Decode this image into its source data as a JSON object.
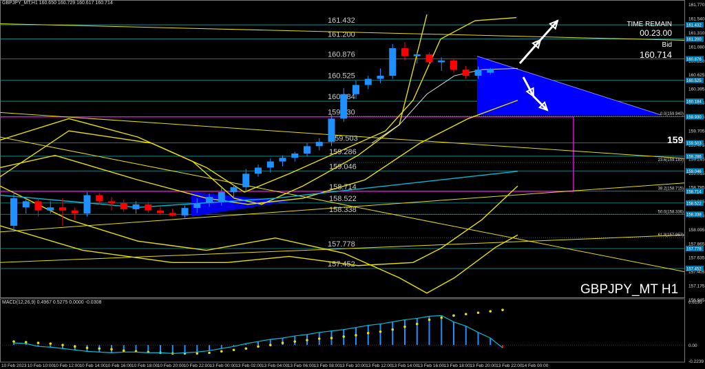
{
  "header": {
    "text": "GBPJPY_MT,H1  160.650 160.729 160.617 160.714"
  },
  "info": {
    "time_remain_label": "TIME REMAIN",
    "time_remain": "00.23.00",
    "bid_label": "Bid",
    "bid": "160.714"
  },
  "symbol_label": "GBPJPY_MT H1",
  "macd_label": "MACD(12,26,9) 0.4967 0.5275 0.0000 -0.0308",
  "big_label": "159",
  "colors": {
    "bull": "#1e90ff",
    "bear": "#ff0000",
    "bands": "#e8e000",
    "cyan": "#00bcd4",
    "magenta": "#ff00ff",
    "triangle": "#0000ff"
  },
  "chart_data": {
    "type": "candlestick",
    "y_range": [
      156.98,
      161.77
    ],
    "y_ticks": [
      "161.770",
      "161.540",
      "161.310",
      "161.080",
      "160.850",
      "160.625",
      "160.395",
      "160.165",
      "159.935",
      "159.705",
      "159.475",
      "159.245",
      "159.015",
      "158.785",
      "158.555",
      "158.325",
      "158.095",
      "157.865",
      "157.635",
      "157.405",
      "157.175",
      "156.945"
    ],
    "price_levels": [
      {
        "label": "161.432",
        "value": 161.432
      },
      {
        "label": "161.200",
        "value": 161.2
      },
      {
        "label": "160.876",
        "value": 160.876
      },
      {
        "label": "160.525",
        "value": 160.525
      },
      {
        "label": "160.184",
        "value": 160.184
      },
      {
        "label": "159.930",
        "value": 159.93
      },
      {
        "label": "159.503",
        "value": 159.503
      },
      {
        "label": "159.286",
        "value": 159.286
      },
      {
        "label": "159.046",
        "value": 159.046
      },
      {
        "label": "158.714",
        "value": 158.714
      },
      {
        "label": "158.522",
        "value": 158.522
      },
      {
        "label": "158.338",
        "value": 158.338
      },
      {
        "label": "157.778",
        "value": 157.778
      },
      {
        "label": "157.452",
        "value": 157.452
      }
    ],
    "fib_labels": [
      {
        "label": "0.0(159.940)",
        "value": 159.94
      },
      {
        "label": "23.6(159.183)",
        "value": 159.183
      },
      {
        "label": "38.2(158.715)",
        "value": 158.715
      },
      {
        "label": "50.0(158.336)",
        "value": 158.336
      },
      {
        "label": "61.8(157.957)",
        "value": 157.957
      }
    ],
    "candles": [
      {
        "o": 158.15,
        "h": 158.7,
        "l": 158.05,
        "c": 158.6
      },
      {
        "o": 158.45,
        "h": 158.62,
        "l": 158.35,
        "c": 158.55
      },
      {
        "o": 158.55,
        "h": 158.6,
        "l": 158.3,
        "c": 158.4
      },
      {
        "o": 158.4,
        "h": 158.55,
        "l": 158.35,
        "c": 158.45
      },
      {
        "o": 158.45,
        "h": 158.6,
        "l": 158.15,
        "c": 158.4
      },
      {
        "o": 158.4,
        "h": 158.45,
        "l": 158.25,
        "c": 158.35
      },
      {
        "o": 158.35,
        "h": 158.7,
        "l": 158.3,
        "c": 158.65
      },
      {
        "o": 158.65,
        "h": 158.68,
        "l": 158.5,
        "c": 158.55
      },
      {
        "o": 158.55,
        "h": 158.62,
        "l": 158.4,
        "c": 158.52
      },
      {
        "o": 158.52,
        "h": 158.58,
        "l": 158.38,
        "c": 158.42
      },
      {
        "o": 158.42,
        "h": 158.55,
        "l": 158.35,
        "c": 158.5
      },
      {
        "o": 158.5,
        "h": 158.54,
        "l": 158.36,
        "c": 158.4
      },
      {
        "o": 158.4,
        "h": 158.46,
        "l": 158.33,
        "c": 158.36
      },
      {
        "o": 158.36,
        "h": 158.43,
        "l": 158.3,
        "c": 158.32
      },
      {
        "o": 158.32,
        "h": 158.48,
        "l": 158.28,
        "c": 158.44
      },
      {
        "o": 158.44,
        "h": 158.6,
        "l": 158.36,
        "c": 158.52
      },
      {
        "o": 158.52,
        "h": 158.68,
        "l": 158.46,
        "c": 158.62
      },
      {
        "o": 158.55,
        "h": 158.78,
        "l": 158.48,
        "c": 158.7
      },
      {
        "o": 158.7,
        "h": 158.82,
        "l": 158.6,
        "c": 158.78
      },
      {
        "o": 158.78,
        "h": 159.08,
        "l": 158.7,
        "c": 159.0
      },
      {
        "o": 159.0,
        "h": 159.15,
        "l": 158.95,
        "c": 159.1
      },
      {
        "o": 159.1,
        "h": 159.25,
        "l": 159.02,
        "c": 159.2
      },
      {
        "o": 159.2,
        "h": 159.3,
        "l": 159.12,
        "c": 159.26
      },
      {
        "o": 159.26,
        "h": 159.36,
        "l": 159.2,
        "c": 159.33
      },
      {
        "o": 159.33,
        "h": 159.5,
        "l": 159.28,
        "c": 159.45
      },
      {
        "o": 159.45,
        "h": 159.58,
        "l": 159.38,
        "c": 159.52
      },
      {
        "o": 159.52,
        "h": 159.98,
        "l": 159.45,
        "c": 159.9
      },
      {
        "o": 159.9,
        "h": 160.4,
        "l": 159.85,
        "c": 160.3
      },
      {
        "o": 160.3,
        "h": 160.52,
        "l": 160.22,
        "c": 160.45
      },
      {
        "o": 160.45,
        "h": 160.6,
        "l": 160.38,
        "c": 160.55
      },
      {
        "o": 160.55,
        "h": 160.72,
        "l": 160.48,
        "c": 160.6
      },
      {
        "o": 160.6,
        "h": 161.12,
        "l": 160.55,
        "c": 161.05
      },
      {
        "o": 161.05,
        "h": 161.15,
        "l": 160.85,
        "c": 160.92
      },
      {
        "o": 160.92,
        "h": 161.0,
        "l": 160.8,
        "c": 160.95
      },
      {
        "o": 160.95,
        "h": 160.98,
        "l": 160.78,
        "c": 160.82
      },
      {
        "o": 160.82,
        "h": 160.9,
        "l": 160.68,
        "c": 160.85
      },
      {
        "o": 160.85,
        "h": 160.88,
        "l": 160.65,
        "c": 160.7
      },
      {
        "o": 160.7,
        "h": 160.76,
        "l": 160.55,
        "c": 160.6
      },
      {
        "o": 160.6,
        "h": 160.75,
        "l": 160.55,
        "c": 160.7
      },
      {
        "o": 160.65,
        "h": 160.73,
        "l": 160.62,
        "c": 160.714
      }
    ],
    "x_labels": [
      "10 Feb 2023",
      "10 Feb 10:00",
      "10 Feb 12:00",
      "10 Feb 14:00",
      "10 Feb 16:00",
      "10 Feb 18:00",
      "10 Feb 20:00",
      "10 Feb 22:00",
      "13 Feb 00:00",
      "13 Feb 02:00",
      "13 Feb 04:00",
      "13 Feb 06:00",
      "13 Feb 08:00",
      "13 Feb 10:00",
      "13 Feb 12:00",
      "13 Feb 14:00",
      "13 Feb 16:00",
      "13 Feb 18:00",
      "13 Feb 20:00",
      "13 Feb 22:00",
      "14 Feb 00:00"
    ],
    "macd": {
      "y_ticks": [
        "0.6195",
        "0.00",
        "-0.2239"
      ],
      "y_range": [
        -0.2239,
        0.6195
      ],
      "histogram": [
        0.03,
        0.02,
        -0.02,
        -0.03,
        -0.05,
        -0.07,
        -0.09,
        -0.1,
        -0.11,
        -0.1,
        -0.1,
        -0.11,
        -0.11,
        -0.12,
        -0.11,
        -0.1,
        -0.08,
        -0.05,
        -0.02,
        0.02,
        0.05,
        0.08,
        0.1,
        0.13,
        0.15,
        0.18,
        0.2,
        0.22,
        0.25,
        0.28,
        0.3,
        0.33,
        0.36,
        0.38,
        0.41,
        0.42,
        0.33,
        0.27,
        0.18,
        0.1,
        -0.04
      ],
      "signal": [
        0.05,
        0.04,
        0.03,
        0.02,
        0.0,
        -0.02,
        -0.04,
        -0.05,
        -0.06,
        -0.08,
        -0.09,
        -0.1,
        -0.11,
        -0.12,
        -0.12,
        -0.12,
        -0.11,
        -0.09,
        -0.07,
        -0.05,
        -0.02,
        0.0,
        0.03,
        0.05,
        0.07,
        0.09,
        0.1,
        0.12,
        0.14,
        0.17,
        0.19,
        0.22,
        0.26,
        0.3,
        0.36,
        0.39,
        0.42,
        0.44,
        0.46,
        0.48,
        0.5
      ]
    }
  }
}
